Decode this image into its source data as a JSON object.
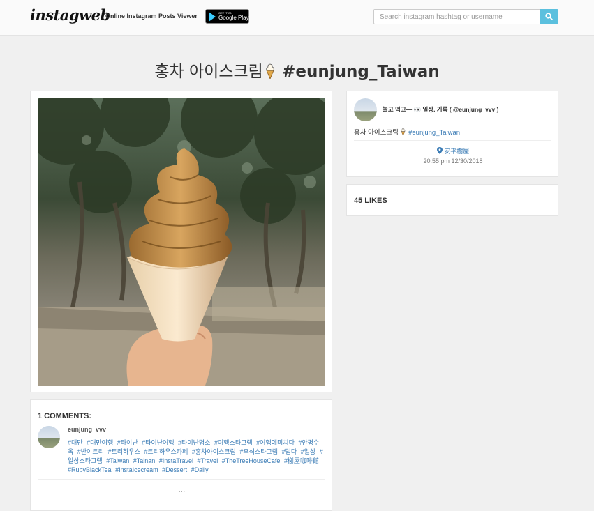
{
  "header": {
    "logo": "instagweb",
    "tagline": "Online Instagram Posts Viewer",
    "store_badge": {
      "small": "GET IT ON",
      "big": "Google Play"
    },
    "search": {
      "placeholder": "Search instagram hashtag or username",
      "value": ""
    },
    "search_icon": "search-icon"
  },
  "post": {
    "title_text": "홍차 아이스크림",
    "title_emoji": "soft-ice-cream-icon",
    "title_hashtag": "#eunjung_Taiwan",
    "author": "놀고 먹고— 👀 일상. 기록 ( @eunjung_vvv )",
    "caption_text": "홍차 아이스크림",
    "caption_hashtag": "#eunjung_Taiwan",
    "location": "安平樹屋",
    "timestamp": "20:55 pm 12/30/2018",
    "likes": "45 LIKES"
  },
  "comments": {
    "title": "1 COMMENTS:",
    "items": [
      {
        "user": "eunjung_vvv",
        "tags": [
          "#대만",
          "#대만여행",
          "#타이난",
          "#타이난여행",
          "#타이난명소",
          "#여행스타그램",
          "#여행에미치다",
          "#안평수옥",
          "#반야트리",
          "#트리하우스",
          "#트리하우스카페",
          "#홍차아이스크림",
          "#후식스타그램",
          "#덥다",
          "#일상",
          "#일상스타그램",
          "#Taiwan",
          "#Tainan",
          "#InstaTravel",
          "#Travel",
          "#TheTreeHouseCafe",
          "#榭屋咖啡館",
          "#RubyBlackTea",
          "#InstaIcecream",
          "#Dessert",
          "#Daily"
        ]
      }
    ],
    "more": "..."
  },
  "colors": {
    "accent": "#5bc0de",
    "link": "#3a7bb5",
    "background": "#f0f0f0"
  }
}
